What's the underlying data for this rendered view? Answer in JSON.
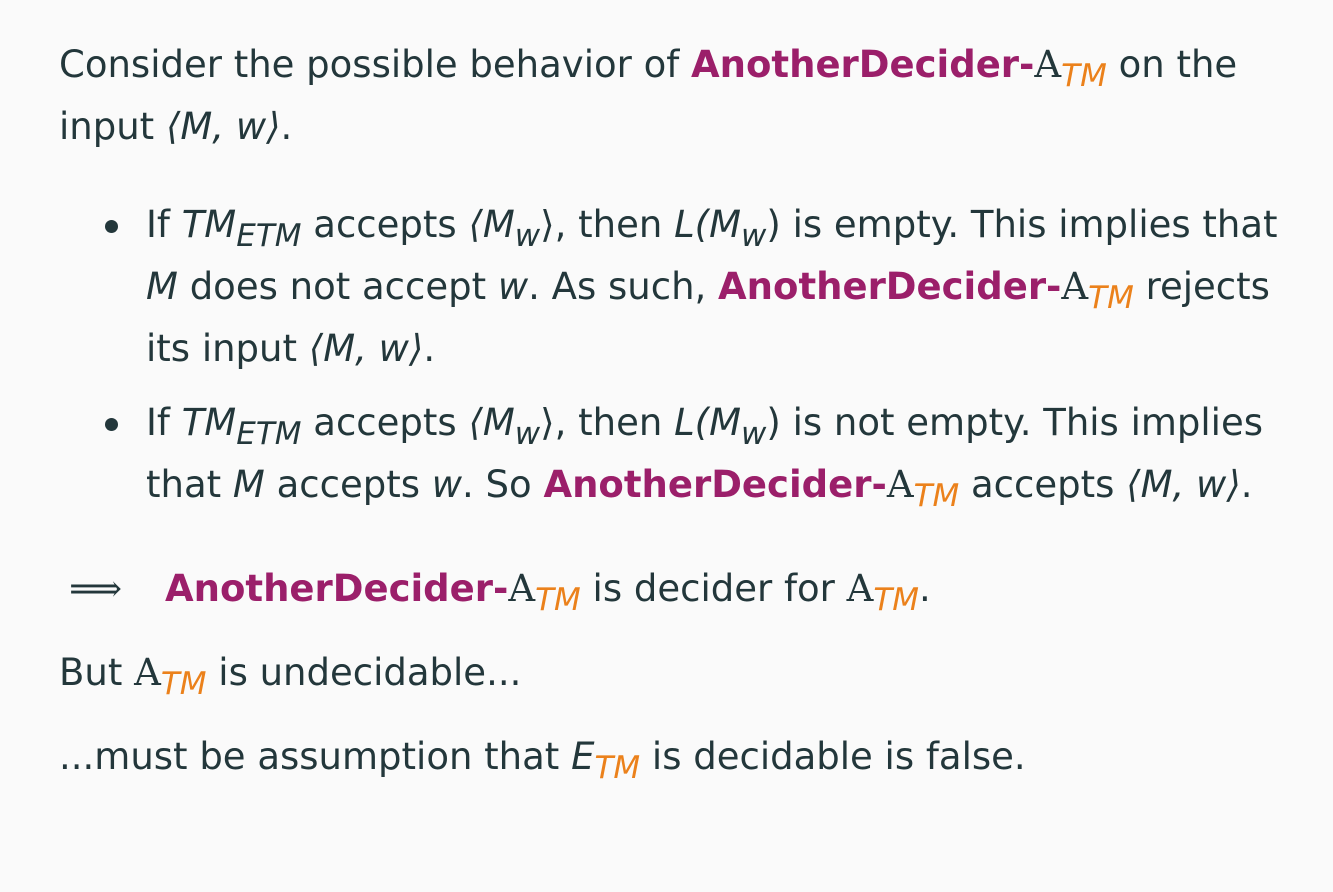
{
  "intro": {
    "t1": "Consider the possible behavior of ",
    "decider_name": "AnotherDecider-",
    "A": "A",
    "TM": "TM",
    "t2": " on the input ",
    "input": "⟨M, w⟩",
    "t3": "."
  },
  "bullets": [
    {
      "t1": "If ",
      "tm": "TM",
      "etm": "ETM",
      "t2": " accepts ",
      "mw_open": "⟨M",
      "w": "w",
      "mw_close": "⟩",
      "t3": ", then ",
      "L": "L(M",
      "Lclose": ")",
      "t4": " is empty. This implies that ",
      "M": "M",
      "t5": " does not accept ",
      "w2": "w",
      "t6": ". As such, ",
      "decider_name": "AnotherDecider-",
      "A": "A",
      "TM": "TM",
      "t7": " rejects its input ",
      "input": "⟨M, w⟩",
      "t8": "."
    },
    {
      "t1": "If ",
      "tm": "TM",
      "etm": "ETM",
      "t2": " accepts ",
      "mw_open": "⟨M",
      "w": "w",
      "mw_close": "⟩",
      "t3": ", then ",
      "L": "L(M",
      "Lclose": ")",
      "t4": " is not empty. This implies that ",
      "M": "M",
      "t5": " accepts ",
      "w2": "w",
      "t6": ". So ",
      "decider_name": "AnotherDecider-",
      "A": "A",
      "TM": "TM",
      "t7": " accepts ",
      "input": "⟨M, w⟩",
      "t8": "."
    }
  ],
  "conclusion": {
    "arrow": "⟹",
    "decider_name": "AnotherDecider-",
    "A": "A",
    "TM": "TM",
    "t1": " is decider for ",
    "A2": "A",
    "TM2": "TM",
    "t2": "."
  },
  "but_line": {
    "t1": "But ",
    "A": "A",
    "TM": "TM",
    "t2": " is undecidable..."
  },
  "final_line": {
    "t1": "...must be assumption that ",
    "E": "E",
    "TM": "TM",
    "t2": " is decidable is false."
  },
  "colors": {
    "text": "#23373b",
    "decider": "#9b1f6a",
    "subscript": "#eb811b",
    "background": "#fafafa"
  }
}
